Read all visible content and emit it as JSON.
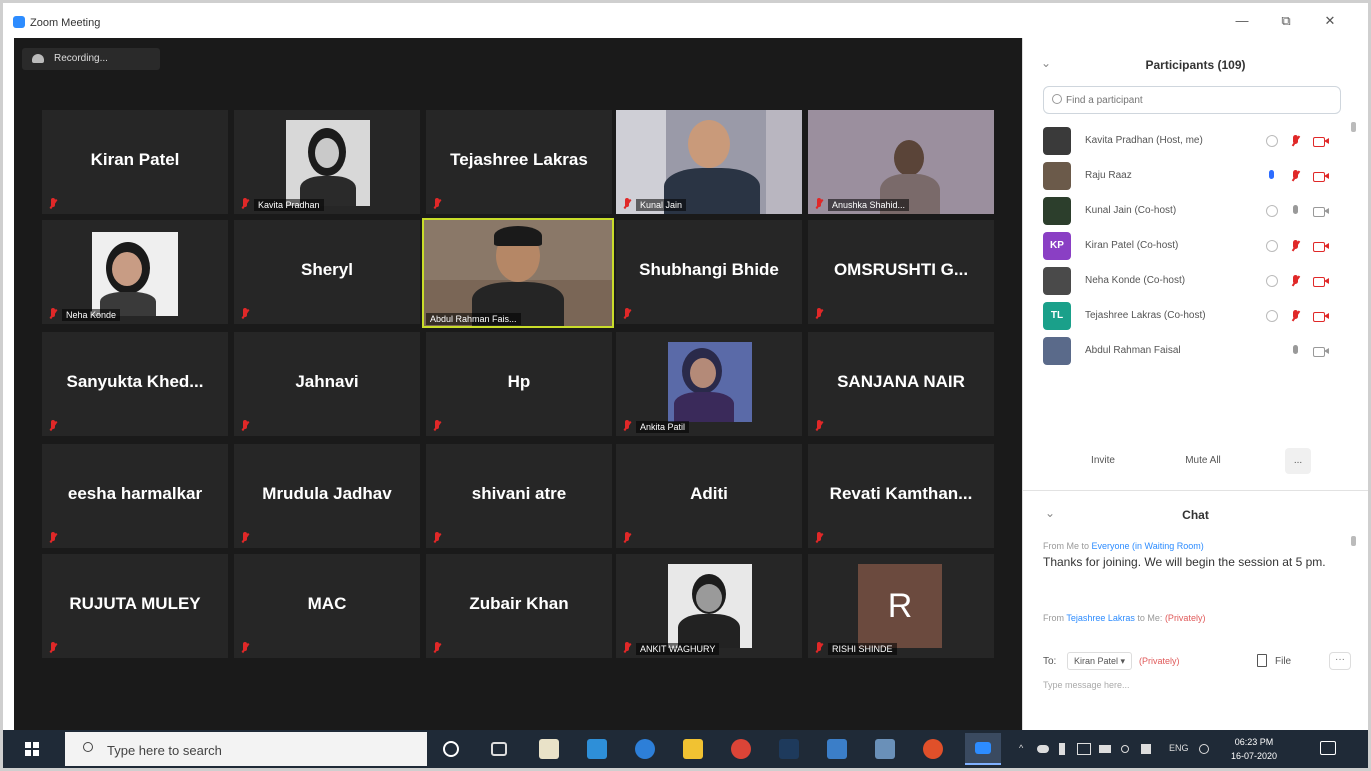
{
  "window": {
    "title": "Zoom Meeting",
    "minimize": "—",
    "restore": "⧉",
    "close": "✕"
  },
  "meeting": {
    "recording_label": "Recording..."
  },
  "tiles": [
    {
      "name": "Kiran Patel",
      "label": ""
    },
    {
      "name": "",
      "label": "Kavita Pradhan"
    },
    {
      "name": "Tejashree Lakras",
      "label": ""
    },
    {
      "name": "",
      "label": "Kunal Jain"
    },
    {
      "name": "",
      "label": "Anushka Shahid..."
    },
    {
      "name": "",
      "label": "Neha Konde"
    },
    {
      "name": "Sheryl",
      "label": ""
    },
    {
      "name": "",
      "label": "Abdul Rahman Fais..."
    },
    {
      "name": "Shubhangi Bhide",
      "label": ""
    },
    {
      "name": "OMSRUSHTI  G...",
      "label": ""
    },
    {
      "name": "Sanyukta  Khed...",
      "label": ""
    },
    {
      "name": "Jahnavi",
      "label": ""
    },
    {
      "name": "Hp",
      "label": ""
    },
    {
      "name": "",
      "label": "Ankita Patil"
    },
    {
      "name": "SANJANA NAIR",
      "label": ""
    },
    {
      "name": "eesha harmalkar",
      "label": ""
    },
    {
      "name": "Mrudula Jadhav",
      "label": ""
    },
    {
      "name": "shivani atre",
      "label": ""
    },
    {
      "name": "Aditi",
      "label": ""
    },
    {
      "name": "Revati  Kamthan...",
      "label": ""
    },
    {
      "name": "RUJUTA MULEY",
      "label": ""
    },
    {
      "name": "MAC",
      "label": ""
    },
    {
      "name": "Zubair Khan",
      "label": ""
    },
    {
      "name": "",
      "label": "ANKIT WAGHURY"
    },
    {
      "name": "",
      "label": "RISHI SHINDE",
      "initial": "R"
    }
  ],
  "participants_panel": {
    "title": "Participants (109)",
    "search_placeholder": "Find a participant",
    "participants": [
      {
        "name": "Kavita Pradhan (Host, me)",
        "avatar": "",
        "avatar_color": "#3a3a3a"
      },
      {
        "name": "Raju Raaz",
        "avatar": "",
        "avatar_color": "#6b5a4a"
      },
      {
        "name": "Kunal Jain (Co-host)",
        "avatar": "",
        "avatar_color": "#2c3e2c"
      },
      {
        "name": "Kiran Patel (Co-host)",
        "avatar": "KP",
        "avatar_color": "#8a3fc4"
      },
      {
        "name": "Neha Konde (Co-host)",
        "avatar": "",
        "avatar_color": "#4a4a4a"
      },
      {
        "name": "Tejashree Lakras (Co-host)",
        "avatar": "TL",
        "avatar_color": "#1aa08a"
      },
      {
        "name": "Abdul Rahman Faisal",
        "avatar": "",
        "avatar_color": "#5a6a8a"
      }
    ],
    "invite_label": "Invite",
    "mute_all_label": "Mute All",
    "more_label": "..."
  },
  "chat": {
    "title": "Chat",
    "messages": [
      {
        "from_prefix": "From Me to",
        "to": "Everyone (in Waiting Room)",
        "privately": "",
        "text": "Thanks for joining. We will begin the session at 5 pm."
      },
      {
        "from_prefix": "From",
        "to": "Tejashree Lakras",
        "to_suffix": "to Me:",
        "privately": "(Privately)",
        "text": ""
      }
    ],
    "to_label": "To:",
    "recipient": "Kiran Patel ▾",
    "recipient_privately": "(Privately)",
    "file_label": "File",
    "more_label": "···",
    "input_placeholder": "Type message here..."
  },
  "taskbar": {
    "search_placeholder": "Type here to search",
    "lang": "ENG",
    "time": "06:23 PM",
    "date": "16-07-2020"
  }
}
